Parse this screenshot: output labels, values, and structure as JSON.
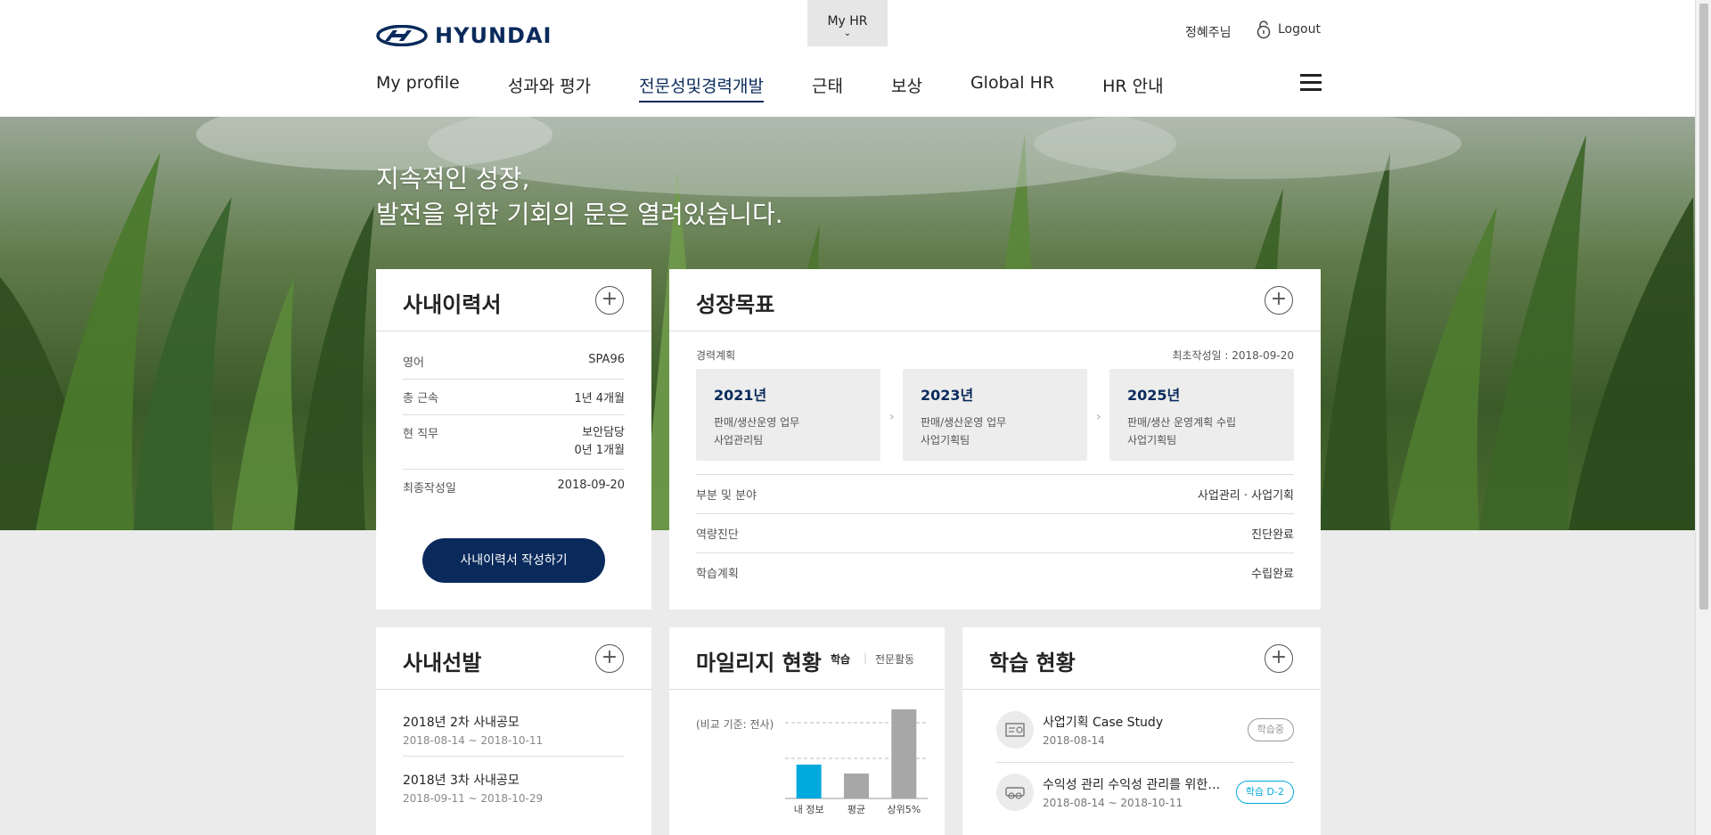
{
  "header": {
    "brand": "HYUNDAI",
    "myhr_label": "My HR",
    "myhr_chevron": "⌄",
    "user_name": "정혜주님",
    "logout_label": "Logout",
    "nav": [
      {
        "label": "My profile"
      },
      {
        "label": "성과와 평가"
      },
      {
        "label": "전문성및경력개발"
      },
      {
        "label": "근태"
      },
      {
        "label": "보상"
      },
      {
        "label": "Global HR"
      },
      {
        "label": "HR 안내"
      }
    ],
    "active_nav_index": 2
  },
  "hero": {
    "line1": "지속적인 성장,",
    "line2": "발전을 위한 기회의 문은 열려있습니다."
  },
  "resume": {
    "title": "사내이력서",
    "rows": [
      {
        "label": "영어",
        "value": "SPA96"
      },
      {
        "label": "총 근속",
        "value": "1년 4개월"
      },
      {
        "label": "현 직무",
        "value": "보안담당",
        "value2": "0년 1개월"
      },
      {
        "label": "최종작성일",
        "value": "2018-09-20"
      }
    ],
    "button_label": "사내이력서 작성하기"
  },
  "growth": {
    "title": "성장목표",
    "plan_label": "경력계획",
    "first_written": "최초작성일 : 2018-09-20",
    "goals": [
      {
        "year": "2021년",
        "line1": "판매/생산운영 업무",
        "line2": "사업관리팀"
      },
      {
        "year": "2023년",
        "line1": "판매/생산운영 업무",
        "line2": "사업기획팀"
      },
      {
        "year": "2025년",
        "line1": "판매/생산 운영계획 수립",
        "line2": "사업기획팀"
      }
    ],
    "rows": [
      {
        "label": "부분 및 분야",
        "value": "사업관리 · 사업기획"
      },
      {
        "label": "역량진단",
        "value": "진단완료"
      },
      {
        "label": "학습계획",
        "value": "수립완료"
      }
    ]
  },
  "selection": {
    "title": "사내선발",
    "items": [
      {
        "title": "2018년 2차 사내공모",
        "date": "2018-08-14 ~ 2018-10-11"
      },
      {
        "title": "2018년 3차 사내공모",
        "date": "2018-09-11 ~ 2018-10-29"
      }
    ]
  },
  "mileage": {
    "title": "마일리지 현황",
    "tab1": "학습",
    "tab2": "전문활동",
    "basis": "(비교 기준: 전사)",
    "chart_data": {
      "type": "bar",
      "categories": [
        "내 정보",
        "평균",
        "상위5%"
      ],
      "values": [
        0.38,
        0.28,
        1.0
      ],
      "colors": [
        "#00aadc",
        "#a7a7a7",
        "#a7a7a7"
      ],
      "grid": "dashed"
    }
  },
  "learning": {
    "title": "학습 현황",
    "items": [
      {
        "title": "사업기획 Case Study",
        "date": "2018-08-14",
        "status": "학습중",
        "status_color": "#999999",
        "icon": "certificate-icon"
      },
      {
        "title": "수익성 관리 수익성 관리를 위한 …",
        "date": "2018-08-14 ~ 2018-10-11",
        "status": "학습 D-2",
        "status_color": "#00aadc",
        "icon": "vr-headset-icon"
      }
    ]
  }
}
